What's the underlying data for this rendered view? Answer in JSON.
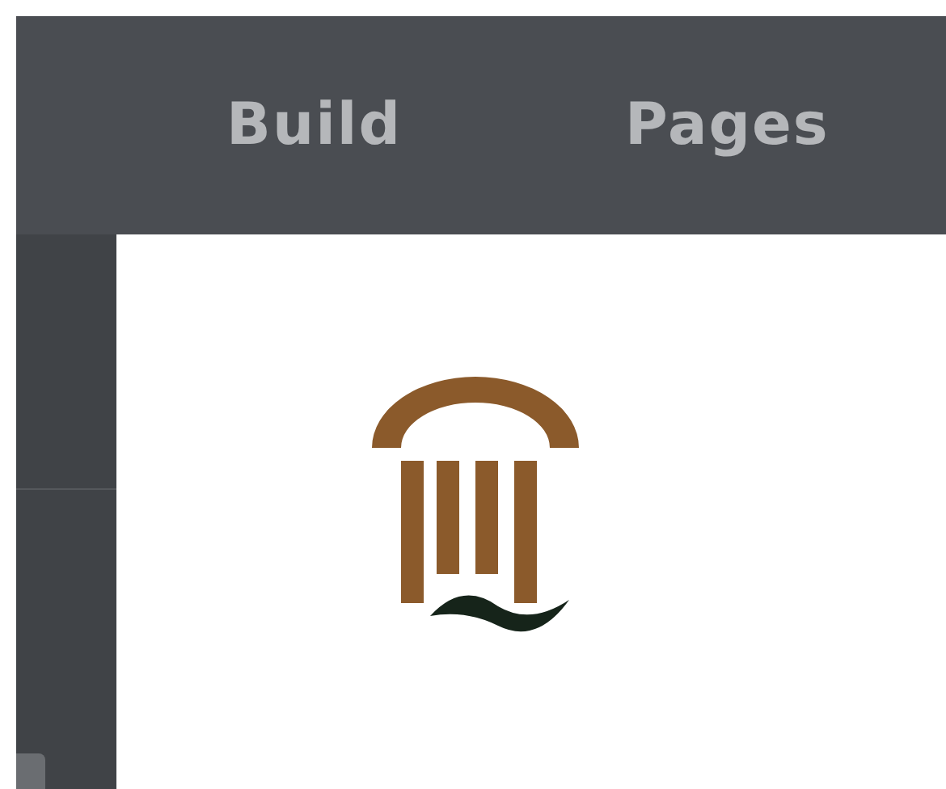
{
  "tabs": [
    {
      "label": "Build"
    },
    {
      "label": "Pages"
    }
  ]
}
